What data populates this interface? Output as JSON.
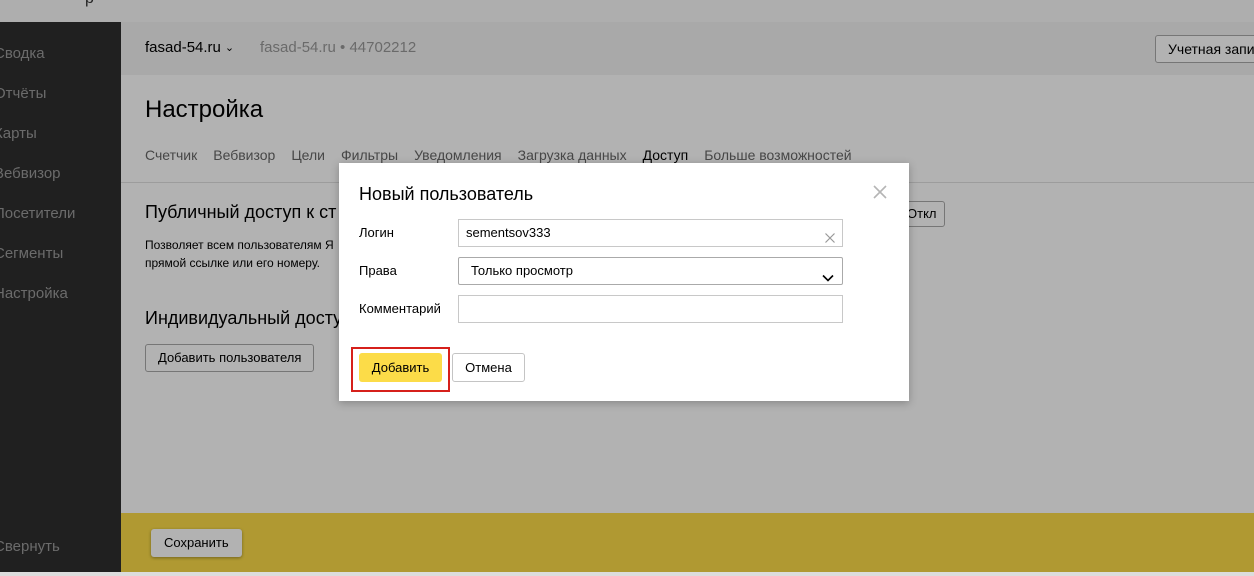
{
  "sidebar": {
    "items": [
      {
        "label": "Сводка"
      },
      {
        "label": "Отчёты"
      },
      {
        "label": "Карты"
      },
      {
        "label": "Вебвизор"
      },
      {
        "label": "Посетители"
      },
      {
        "label": "Сегменты"
      },
      {
        "label": "Настройка"
      }
    ],
    "collapse_label": "Свернуть"
  },
  "header": {
    "site_name": "fasad-54.ru",
    "counter_info": "fasad-54.ru • 44702212",
    "account_label": "Учетная запись"
  },
  "page": {
    "title": "Настройка",
    "tabs": [
      {
        "label": "Счетчик"
      },
      {
        "label": "Вебвизор"
      },
      {
        "label": "Цели"
      },
      {
        "label": "Фильтры"
      },
      {
        "label": "Уведомления"
      },
      {
        "label": "Загрузка данных"
      },
      {
        "label": "Доступ",
        "active": true
      },
      {
        "label": "Больше возможностей"
      }
    ],
    "public_access_title": "Публичный доступ к ст",
    "public_access_desc_line1": "Позволяет всем пользователям Я",
    "public_access_desc_line2": "прямой ссылке или его номеру.",
    "public_toggle_label": "Откл",
    "individual_access_title": "Индивидуальный досту",
    "add_user_label": "Добавить пользователя",
    "save_label": "Сохранить"
  },
  "modal": {
    "title": "Новый пользователь",
    "login_label": "Логин",
    "login_value": "sementsov333",
    "rights_label": "Права",
    "rights_value": "Только просмотр",
    "comment_label": "Комментарий",
    "comment_value": "",
    "add_label": "Добавить",
    "cancel_label": "Отмена"
  },
  "colors": {
    "accent_yellow": "#fcdc48",
    "highlight_red": "#d6201b",
    "sidebar_bg": "#2f2f2f"
  }
}
